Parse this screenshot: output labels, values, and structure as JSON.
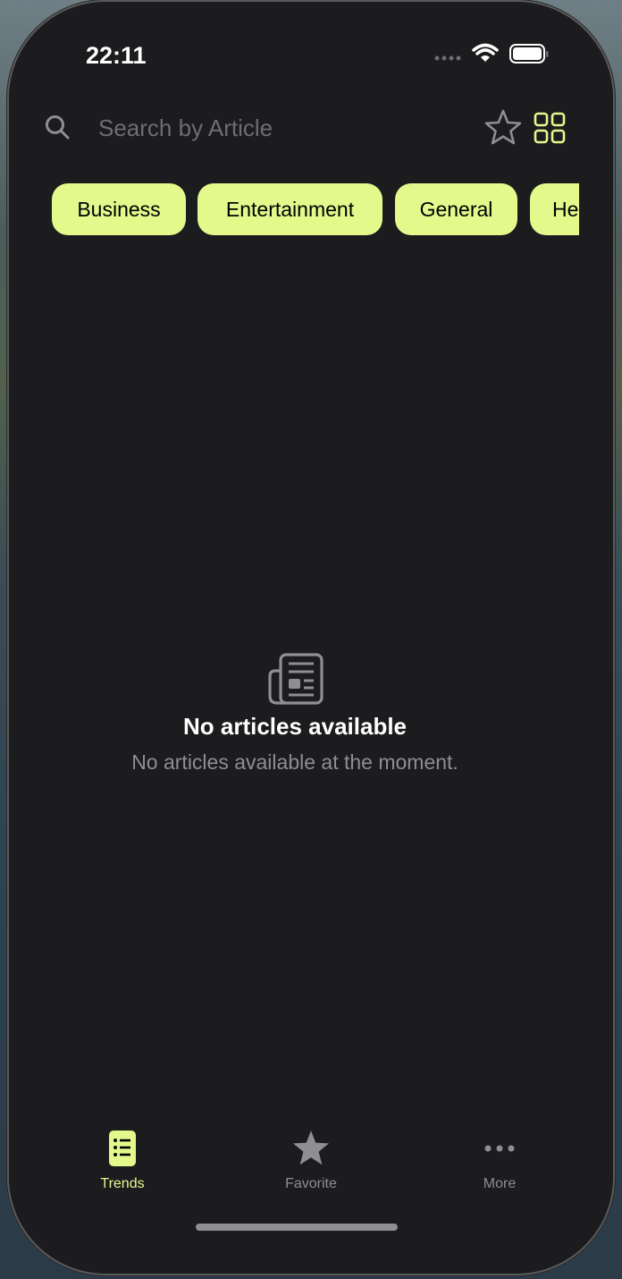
{
  "status_bar": {
    "time": "22:11"
  },
  "search": {
    "placeholder": "Search by Article"
  },
  "header_actions": {
    "favorites_icon": "star-outline-icon",
    "layout_icon": "grid-icon"
  },
  "categories": [
    "Business",
    "Entertainment",
    "General",
    "Heal"
  ],
  "empty_state": {
    "icon": "newspaper-icon",
    "title": "No articles available",
    "subtitle": "No articles available at the moment."
  },
  "tab_bar": {
    "tabs": [
      {
        "label": "Trends",
        "icon": "list-icon",
        "active": true
      },
      {
        "label": "Favorite",
        "icon": "star-icon",
        "active": false
      },
      {
        "label": "More",
        "icon": "ellipsis-icon",
        "active": false
      }
    ]
  },
  "colors": {
    "accent": "#e4f98c",
    "background": "#000000",
    "inactive": "#8e8e93"
  }
}
